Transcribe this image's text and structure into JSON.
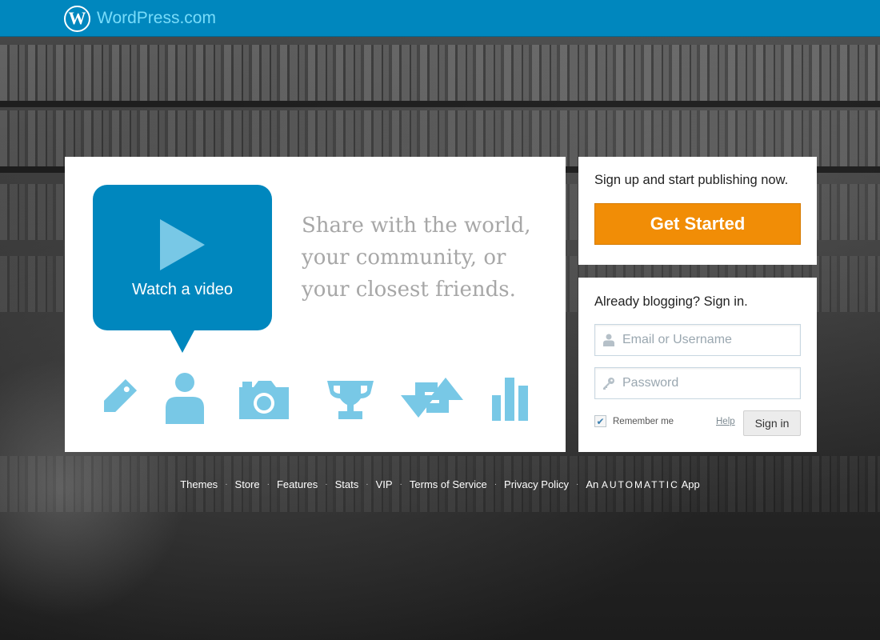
{
  "header": {
    "logo_letter": "W",
    "brand": "WordPress.com",
    "brand_color": "#78dcfa",
    "bar_color": "#0087be"
  },
  "promo": {
    "video_label": "Watch a video",
    "tagline": [
      "Share with the world,",
      "your community, or",
      "your closest friends."
    ],
    "feature_icons": [
      "tag-icon",
      "person-icon",
      "camera-icon",
      "trophy-icon",
      "reblog-icon",
      "stats-icon"
    ],
    "icon_color": "#78c8e6"
  },
  "signup": {
    "text": "Sign up and start publishing now.",
    "button": "Get Started",
    "button_color": "#f18d06"
  },
  "signin": {
    "text": "Already blogging? Sign in.",
    "username_placeholder": "Email or Username",
    "password_placeholder": "Password",
    "remember_label": "Remember me",
    "remember_checked": true,
    "help": "Help",
    "button": "Sign in"
  },
  "footer": {
    "links": [
      "Themes",
      "Store",
      "Features",
      "Stats",
      "VIP",
      "Terms of Service",
      "Privacy Policy"
    ],
    "credit_prefix": "An",
    "credit_company": "AUTOMATTIC",
    "credit_suffix": "App"
  }
}
